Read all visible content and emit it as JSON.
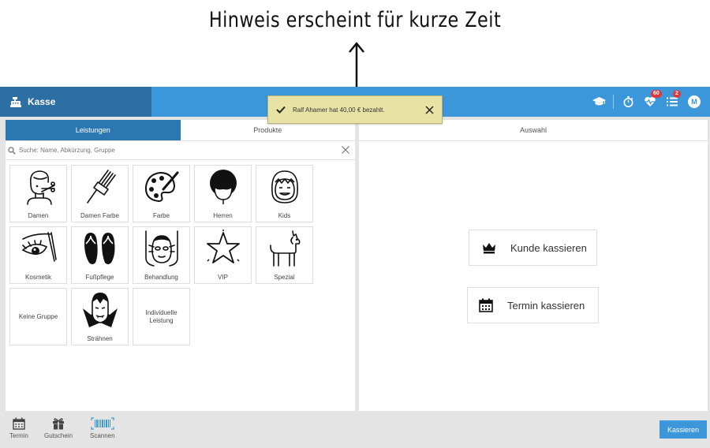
{
  "annotation": {
    "text": "Hinweis erscheint für kurze Zeit"
  },
  "header": {
    "app_title": "Kasse",
    "notification_badge": "60",
    "tasks_badge": "2",
    "avatar_initial": "M"
  },
  "toast": {
    "message": "Ralf Ahamer hat  40,00 € bezahlt."
  },
  "left_panel": {
    "tabs": [
      {
        "label": "Leistungen",
        "active": true
      },
      {
        "label": "Produkte",
        "active": false
      }
    ],
    "search": {
      "placeholder": "Suche: Name, Abkürzung, Gruppe"
    },
    "groups": [
      {
        "label": "Damen",
        "icon": "woman-hair-icon"
      },
      {
        "label": "Damen Farbe",
        "icon": "hair-dye-brush-icon"
      },
      {
        "label": "Farbe",
        "icon": "palette-icon"
      },
      {
        "label": "Herren",
        "icon": "man-head-icon"
      },
      {
        "label": "Kids",
        "icon": "kid-face-icon"
      },
      {
        "label": "Kosmetik",
        "icon": "eye-lash-icon"
      },
      {
        "label": "Fußpflege",
        "icon": "flip-flops-icon"
      },
      {
        "label": "Behandlung",
        "icon": "face-mask-icon"
      },
      {
        "label": "VIP",
        "icon": "star-icon"
      },
      {
        "label": "Spezial",
        "icon": "llama-icon"
      },
      {
        "label": "Keine Gruppe",
        "icon": ""
      },
      {
        "label": "Strähnen",
        "icon": "vampire-icon"
      },
      {
        "label": "Individuelle Leistung",
        "icon": ""
      }
    ]
  },
  "right_panel": {
    "header": "Auswahl",
    "actions": [
      {
        "label": "Kunde kassieren",
        "icon": "crown-icon"
      },
      {
        "label": "Termin kassieren",
        "icon": "calendar-icon"
      }
    ]
  },
  "bottom_bar": {
    "items": [
      {
        "label": "Termin",
        "icon": "calendar-icon"
      },
      {
        "label": "Gutschein",
        "icon": "gift-icon"
      },
      {
        "label": "Scannen",
        "icon": "barcode-icon"
      }
    ],
    "pay_label": "Kassieren"
  },
  "colors": {
    "topbar": "#3b97da",
    "brand": "#2c6fa3",
    "active_tab": "#2a77b1",
    "toast": "#e8e3a4",
    "badge": "#e0373c"
  }
}
